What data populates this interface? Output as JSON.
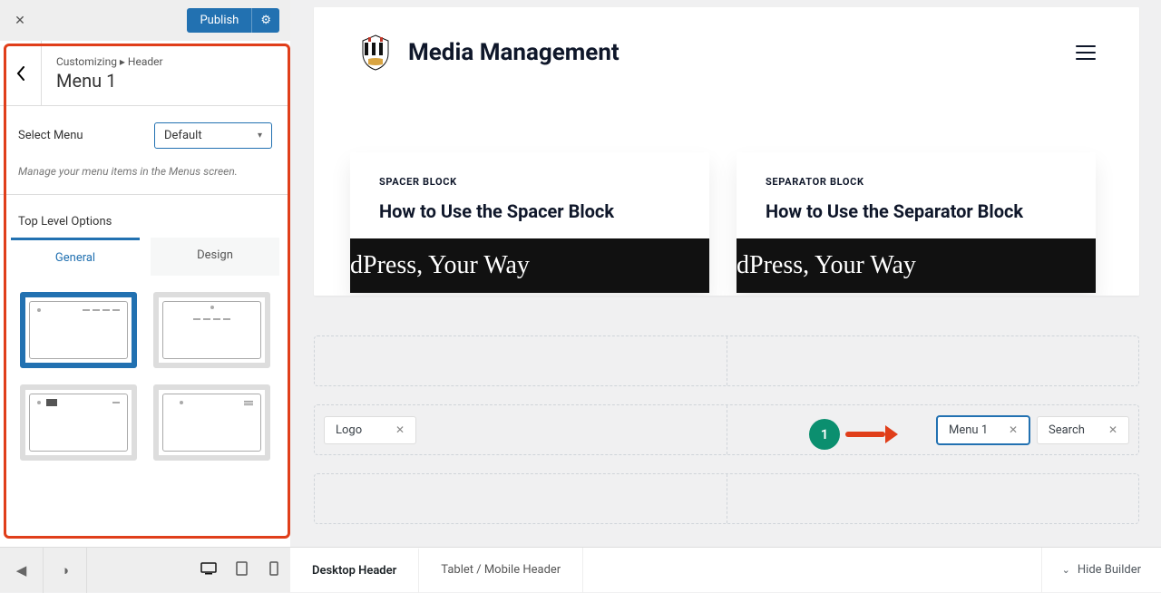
{
  "top": {
    "publish": "Publish"
  },
  "panel": {
    "breadcrumb": "Customizing ▸ Header",
    "title": "Menu 1",
    "select_label": "Select Menu",
    "select_value": "Default",
    "hint": "Manage your menu items in the Menus screen.",
    "options_title": "Top Level Options",
    "tab_general": "General",
    "tab_design": "Design"
  },
  "preview": {
    "site_title": "Media Management",
    "card1_cat": "SPACER BLOCK",
    "card1_title": "How to Use the Spacer Block",
    "card1_img_text": "dPress, Your Way",
    "card2_cat": "SEPARATOR BLOCK",
    "card2_title": "How to Use the Separator Block",
    "card2_img_text": "dPress, Your Way"
  },
  "builder": {
    "chip_logo": "Logo",
    "chip_menu1": "Menu 1",
    "chip_search": "Search"
  },
  "annotation": {
    "number": "1"
  },
  "footer": {
    "tab_desktop": "Desktop Header",
    "tab_mobile": "Tablet / Mobile Header",
    "hide": "Hide Builder"
  }
}
